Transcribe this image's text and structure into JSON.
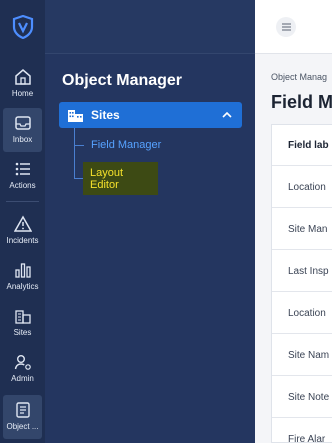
{
  "rail": {
    "items": [
      {
        "label": "Home",
        "icon": "home-icon"
      },
      {
        "label": "Inbox",
        "icon": "inbox-icon"
      },
      {
        "label": "Actions",
        "icon": "list-icon"
      },
      {
        "label": "Incidents",
        "icon": "warning-icon"
      },
      {
        "label": "Analytics",
        "icon": "bar-chart-icon"
      },
      {
        "label": "Sites",
        "icon": "sites-icon"
      },
      {
        "label": "Admin",
        "icon": "admin-icon"
      },
      {
        "label": "Object ...",
        "icon": "object-icon"
      }
    ]
  },
  "panel": {
    "title": "Object Manager",
    "sites_label": "Sites",
    "sub_items": [
      "Field Manager",
      "Layout Editor"
    ]
  },
  "main": {
    "breadcrumb": "Object Manag",
    "page_title": "Field M",
    "table": {
      "header": "Field lab",
      "rows": [
        "Location",
        "Site Man",
        "Last Insp",
        "Location",
        "Site Nam",
        "Site Note",
        "Fire Alar"
      ]
    }
  },
  "colors": {
    "rail_bg": "#1f2f52",
    "panel_bg": "#243660",
    "accent": "#1f6fd6",
    "highlight_bg": "#3d4a14",
    "highlight_text": "#f5e12b",
    "link": "#56a2ff"
  }
}
